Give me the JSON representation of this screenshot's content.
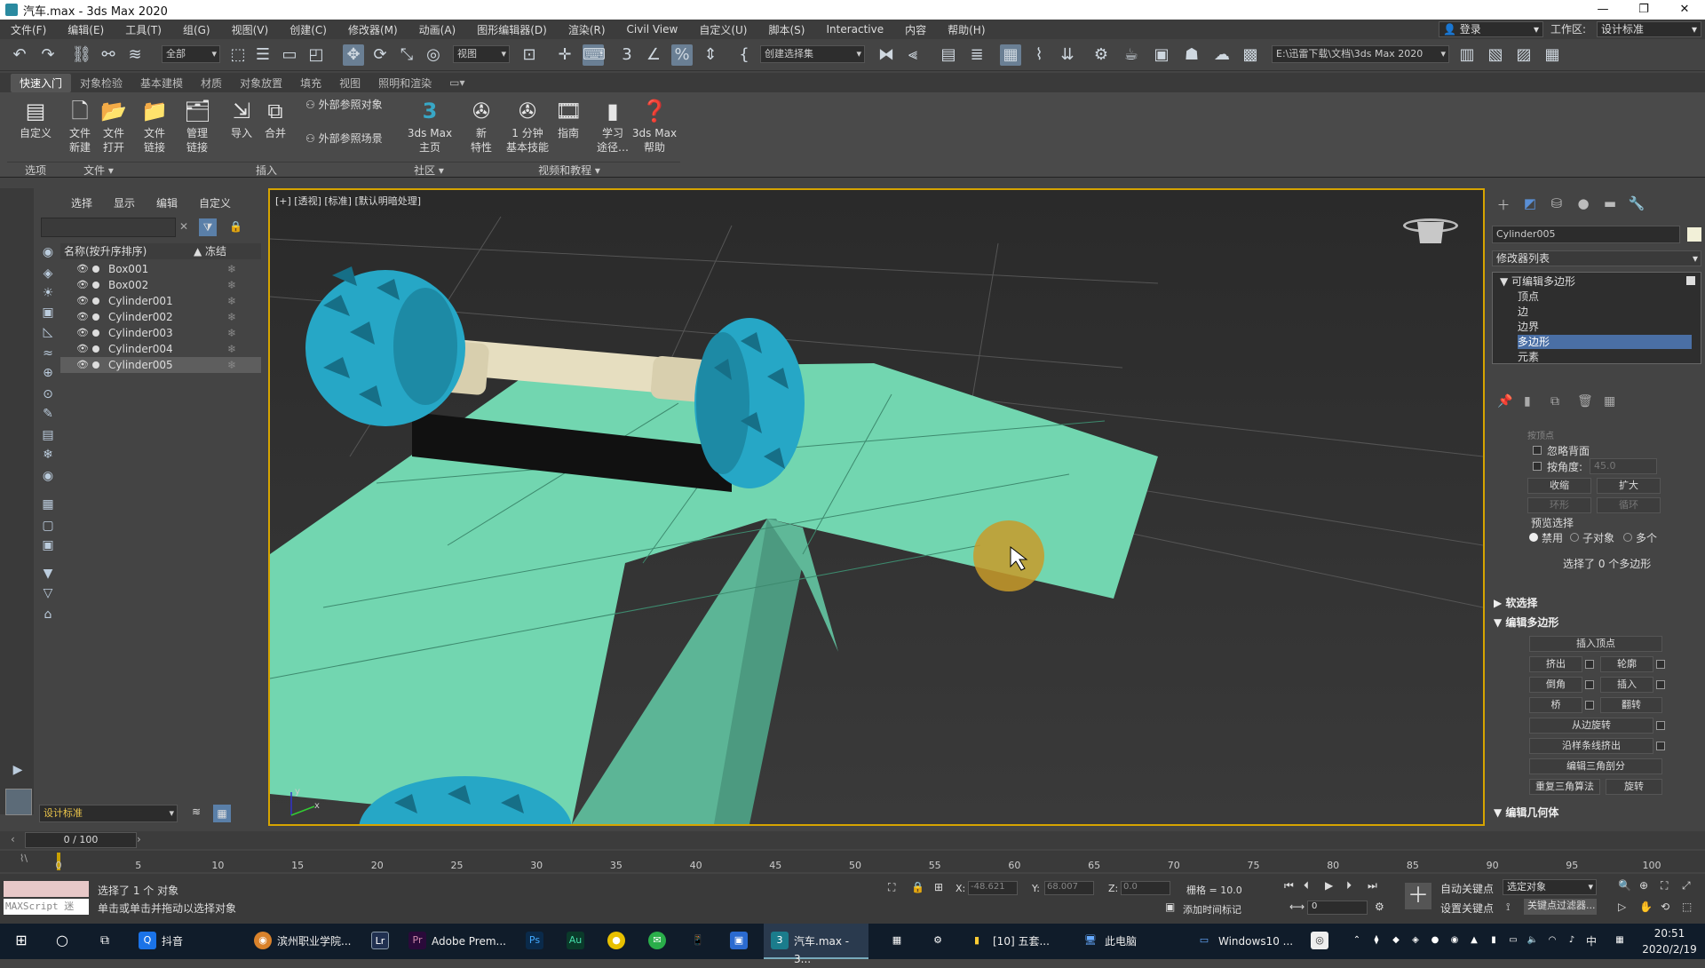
{
  "window": {
    "title": "汽车.max - 3ds Max 2020",
    "minimize": "—",
    "maximize": "❐",
    "close": "✕"
  },
  "menu": [
    "文件(F)",
    "编辑(E)",
    "工具(T)",
    "组(G)",
    "视图(V)",
    "创建(C)",
    "修改器(M)",
    "动画(A)",
    "图形编辑器(D)",
    "渲染(R)",
    "Civil View",
    "自定义(U)",
    "脚本(S)",
    "Interactive",
    "内容",
    "帮助(H)"
  ],
  "account": {
    "login": "登录",
    "workspace_label": "工作区:",
    "workspace_value": "设计标准"
  },
  "toolbar": {
    "selection_filter": "全部",
    "reference_coord": "视图",
    "named_selection": "创建选择集",
    "project_path": "E:\\迅雷下载\\文档\\3ds Max 2020"
  },
  "ribbon_tabs": [
    "快速入门",
    "对象检验",
    "基本建模",
    "材质",
    "对象放置",
    "填充",
    "视图",
    "照明和渲染"
  ],
  "ribbon": {
    "customize": "自定义",
    "file_new": "文件\n新建",
    "file_open": "文件\n打开",
    "file_link": "文件\n链接",
    "manage_link": "管理\n链接",
    "import": "导入",
    "merge": "合并",
    "xref_objects": "外部参照对象",
    "xref_scene": "外部参照场景",
    "home": "3ds Max\n主页",
    "new_features": "新\n特性",
    "one_minute": "1 分钟\n基本技能",
    "guide": "指南",
    "learn": "学习\n途径…",
    "help": "3ds Max\n帮助",
    "groups": {
      "options": "选项",
      "file": "文件 ▾",
      "insert": "插入",
      "community": "社区 ▾",
      "videos": "视频和教程 ▾"
    }
  },
  "scene_explorer": {
    "tabs": [
      "选择",
      "显示",
      "编辑",
      "自定义"
    ],
    "col_name": "名称(按升序排序)",
    "col_frozen": "▲ 冻结",
    "objects": [
      {
        "name": "Box001",
        "selected": false
      },
      {
        "name": "Box002",
        "selected": false
      },
      {
        "name": "Cylinder001",
        "selected": false
      },
      {
        "name": "Cylinder002",
        "selected": false
      },
      {
        "name": "Cylinder003",
        "selected": false
      },
      {
        "name": "Cylinder004",
        "selected": false
      },
      {
        "name": "Cylinder005",
        "selected": true
      }
    ],
    "workspace_dropdown": "设计标准"
  },
  "viewport": {
    "label": "[+] [透视] [标准] [默认明暗处理]",
    "gizmo_x": "x",
    "gizmo_y": "y",
    "colors": {
      "ground": "#72d6b0",
      "wheel": "#26a7c6",
      "axle": "#e6dec0",
      "cursor_ring": "#c89b2a"
    }
  },
  "command_panel": {
    "object_name": "Cylinder005",
    "modifier_list": "修改器列表",
    "stack_root": "可编辑多边形",
    "sub_objects": [
      "顶点",
      "边",
      "边界",
      "多边形",
      "元素"
    ],
    "selected_sub": "多边形",
    "selection": {
      "by_vertex": "按顶点",
      "ignore_backface": "忽略背面",
      "by_angle": "按角度:",
      "angle_value": "45.0",
      "shrink": "收缩",
      "grow": "扩大",
      "ring": "环形",
      "loop": "循环",
      "preview_label": "预览选择",
      "preview_options": [
        "禁用",
        "子对象",
        "多个"
      ],
      "status": "选择了 0 个多边形"
    },
    "soft_selection": "软选择",
    "edit_polygons": {
      "title": "编辑多边形",
      "insert_vertex": "插入顶点",
      "extrude": "挤出",
      "outline": "轮廓",
      "bevel": "倒角",
      "inset": "插入",
      "bridge": "桥",
      "flip": "翻转",
      "hinge": "从边旋转",
      "extrude_spline": "沿样条线挤出",
      "edit_tri": "编辑三角剖分",
      "retriangulate": "重复三角算法",
      "turn": "旋转"
    },
    "edit_geometry": "编辑几何体"
  },
  "timeline": {
    "slider": "0 / 100",
    "ticks": [
      0,
      5,
      10,
      15,
      20,
      25,
      30,
      35,
      40,
      45,
      50,
      55,
      60,
      65,
      70,
      75,
      80,
      85,
      90,
      95,
      100
    ]
  },
  "status": {
    "maxscript": "MAXScript 迷",
    "selected": "选择了 1 个 对象",
    "prompt": "单击或单击并拖动以选择对象",
    "x_label": "X:",
    "x_value": "-48.621",
    "y_label": "Y:",
    "y_value": "68.007",
    "z_label": "Z:",
    "z_value": "0.0",
    "grid": "栅格 = 10.0",
    "add_time_tag": "添加时间标记",
    "auto_key": "自动关键点",
    "set_key": "设置关键点",
    "key_filter_dd": "选定对象",
    "key_filters": "关键点过滤器...",
    "frame": "0"
  },
  "taskbar": {
    "items": [
      "抖音",
      "滨州职业学院...",
      "Adobe Prem...",
      "汽车.max - 3...",
      "[10] 五套...",
      "此电脑",
      "Windows10 ..."
    ],
    "time": "20:51",
    "date": "2020/2/19",
    "ime": "中"
  }
}
